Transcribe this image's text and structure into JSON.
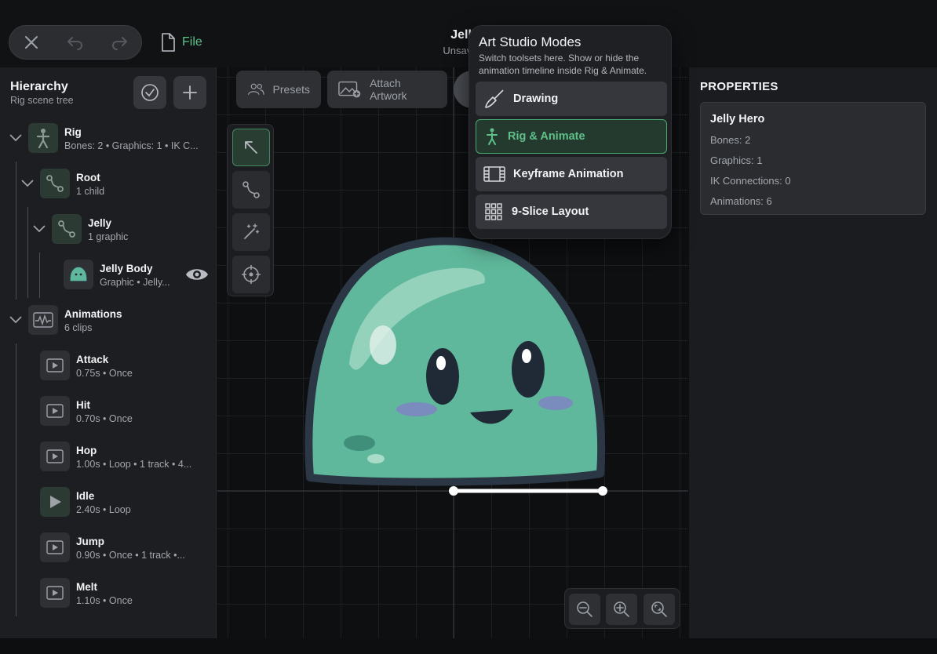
{
  "header": {
    "file_label": "File",
    "doc_title": "Jelly H",
    "doc_status": "Unsaved"
  },
  "hierarchy": {
    "title": "Hierarchy",
    "subtitle": "Rig scene tree",
    "nodes": [
      {
        "title": "Rig",
        "sub": "Bones: 2  •  Graphics: 1  •  IK C..."
      },
      {
        "title": "Root",
        "sub": "1 child"
      },
      {
        "title": "Jelly",
        "sub": "1 graphic"
      },
      {
        "title": "Jelly Body",
        "sub": "Graphic  •  Jelly..."
      },
      {
        "title": "Animations",
        "sub": "6 clips"
      }
    ],
    "clips": [
      {
        "title": "Attack",
        "sub": "0.75s  •  Once"
      },
      {
        "title": "Hit",
        "sub": "0.70s  •  Once"
      },
      {
        "title": "Hop",
        "sub": "1.00s  •  Loop  •  1 track  •  4..."
      },
      {
        "title": "Idle",
        "sub": "2.40s  •  Loop"
      },
      {
        "title": "Jump",
        "sub": "0.90s  •  Once  •  1 track  •..."
      },
      {
        "title": "Melt",
        "sub": "1.10s  •  Once"
      }
    ]
  },
  "canvas_toolbar": {
    "presets_label": "Presets",
    "attach_label": "Attach Artwork"
  },
  "modes_popover": {
    "title": "Art Studio Modes",
    "description": "Switch toolsets here. Show or hide the animation timeline inside Rig & Animate.",
    "modes": [
      {
        "label": "Drawing",
        "icon": "brush-icon"
      },
      {
        "label": "Rig & Animate",
        "icon": "figure-icon"
      },
      {
        "label": "Keyframe Animation",
        "icon": "film-icon"
      },
      {
        "label": "9-Slice Layout",
        "icon": "grid-icon"
      }
    ],
    "active_mode": "Rig & Animate"
  },
  "properties": {
    "title": "PROPERTIES",
    "name": "Jelly Hero",
    "lines": [
      "Bones: 2",
      "Graphics: 1",
      "IK Connections: 0",
      "Animations: 6"
    ]
  },
  "colors": {
    "accent_green": "#5fc08a",
    "jelly_body": "#5fb89b",
    "panel": "#1d1e21"
  }
}
